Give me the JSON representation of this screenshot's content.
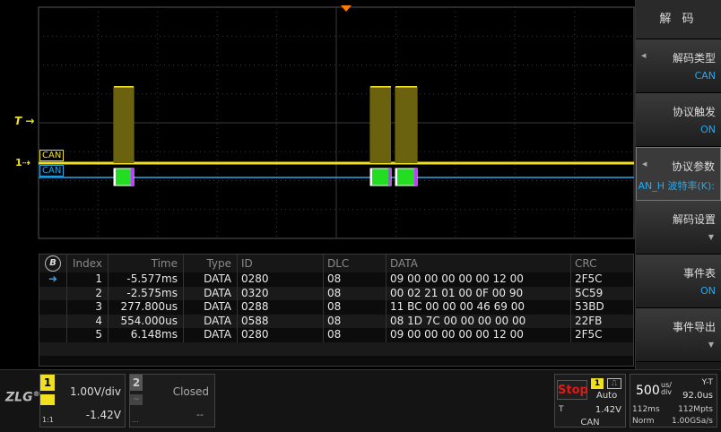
{
  "waveform": {
    "ch_labels": [
      "CAN",
      "CAN"
    ],
    "trigger_marker": "T",
    "ch1_marker": "1",
    "colors": {
      "ch1": "#f0e020",
      "decode": "#2aa7e8",
      "frame": "#22dd22",
      "grid": "#3a3a3a"
    }
  },
  "decode_table": {
    "badge_icon": "bus-b-icon",
    "badge": "B",
    "headers": {
      "index": "Index",
      "time": "Time",
      "type": "Type",
      "id": "ID",
      "dlc": "DLC",
      "data": "DATA",
      "crc": "CRC"
    },
    "selected_icon": "arrow-right-icon",
    "rows": [
      {
        "index": "1",
        "time": "-5.577ms",
        "type": "DATA",
        "id": "0280",
        "dlc": "08",
        "data": "09 00 00 00 00 00 12 00",
        "crc": "2F5C"
      },
      {
        "index": "2",
        "time": "-2.575ms",
        "type": "DATA",
        "id": "0320",
        "dlc": "08",
        "data": "00 02 21 01 00 0F 00 90",
        "crc": "5C59"
      },
      {
        "index": "3",
        "time": "277.800us",
        "type": "DATA",
        "id": "0288",
        "dlc": "08",
        "data": "11 BC 00 00 00 46 69 00",
        "crc": "53BD"
      },
      {
        "index": "4",
        "time": "554.000us",
        "type": "DATA",
        "id": "0588",
        "dlc": "08",
        "data": "08 1D 7C 00 00 00 00 00",
        "crc": "22FB"
      },
      {
        "index": "5",
        "time": "6.148ms",
        "type": "DATA",
        "id": "0280",
        "dlc": "08",
        "data": "09 00 00 00 00 00 12 00",
        "crc": "2F5C"
      }
    ]
  },
  "menu": {
    "title": "解 码",
    "items": [
      {
        "label": "解码类型",
        "value": "CAN"
      },
      {
        "label": "协议触发",
        "value": "ON"
      },
      {
        "label": "协议参数",
        "value": "AN_H  波特率(K):"
      },
      {
        "label": "解码设置",
        "value": ""
      },
      {
        "label": "事件表",
        "value": "ON"
      },
      {
        "label": "事件导出",
        "value": ""
      }
    ]
  },
  "bottom": {
    "logo": "ZLG",
    "logo_mark": "®",
    "ch1": {
      "num": "1",
      "vdiv": "1.00V/div",
      "offset": "-1.42V",
      "ratio": "1:1"
    },
    "ch2": {
      "num": "2",
      "coupling": "~",
      "status": "Closed",
      "offset": "--",
      "ratio": "..."
    },
    "trigger": {
      "state": "Stop",
      "source": "1",
      "type_icon": "edge-icon",
      "mode": "Auto",
      "t_label": "T",
      "level": "1.42V",
      "protocol": "CAN"
    },
    "timebase": {
      "value": "500",
      "unit_top": "us/",
      "unit_bottom": "div",
      "mode": "Y-T",
      "delay": "92.0us",
      "span": "112ms",
      "points": "112Mpts",
      "acq": "Norm",
      "rate": "1.00GSa/s"
    }
  }
}
